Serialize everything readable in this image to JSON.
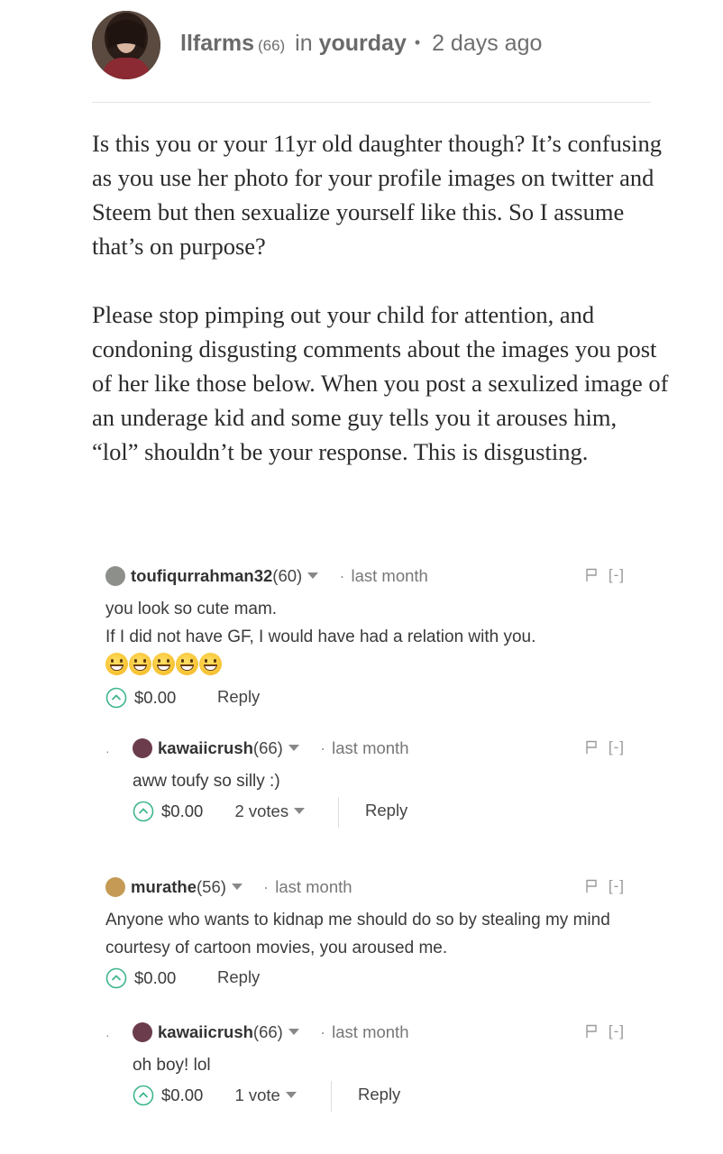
{
  "post": {
    "author": "llfarms",
    "author_rep": "(66)",
    "in_label": "in",
    "category": "yourday",
    "separator": "•",
    "time": "2 days ago",
    "paragraphs": [
      "Is this you or your 11yr old daughter though? It’s confusing as you use her photo for your profile images on twitter and Steem but then sexualize yourself like this. So I assume that’s on purpose?",
      "Please stop pimping out your child for attention, and condoning disgusting comments about the images you post of her like those below. When you post a sexulized image of an underage kid and some guy tells you it arouses him, “lol” shouldn’t be your response. This is disgusting."
    ]
  },
  "comments": [
    {
      "user": "toufiqurrahman32",
      "rep": "(60)",
      "dot": "·",
      "time": "last month",
      "lines": [
        "you look so cute mam.",
        "If I did not have GF, I would have had a relation with you."
      ],
      "payout": "$0.00",
      "reply": "Reply",
      "collapse": "[-]",
      "avatar_color": "#8d8f8a"
    },
    {
      "user": "kawaiicrush",
      "rep": "(66)",
      "dot": "·",
      "time": "last month",
      "lines": [
        "aww toufy so silly :)"
      ],
      "payout": "$0.00",
      "votes": "2 votes",
      "reply": "Reply",
      "collapse": "[-]",
      "avatar_color": "#6b3c4c"
    },
    {
      "user": "murathe",
      "rep": "(56)",
      "dot": "·",
      "time": "last month",
      "lines": [
        "Anyone who wants to kidnap me should do so by stealing my mind courtesy of cartoon movies, you aroused me."
      ],
      "payout": "$0.00",
      "reply": "Reply",
      "collapse": "[-]",
      "avatar_color": "#c49a55"
    },
    {
      "user": "kawaiicrush",
      "rep": "(66)",
      "dot": "·",
      "time": "last month",
      "lines": [
        "oh boy! lol"
      ],
      "payout": "$0.00",
      "votes": "1 vote",
      "reply": "Reply",
      "collapse": "[-]",
      "avatar_color": "#6b3c4c"
    }
  ],
  "icons": {
    "vote": "upvote-circle-icon",
    "flag": "flag-icon",
    "caret": "chevron-down-icon",
    "emoji": "grinning-face-icon"
  },
  "colors": {
    "upvote_accent": "#3eb58e",
    "text": "#2b2b2b",
    "muted": "#777777"
  }
}
